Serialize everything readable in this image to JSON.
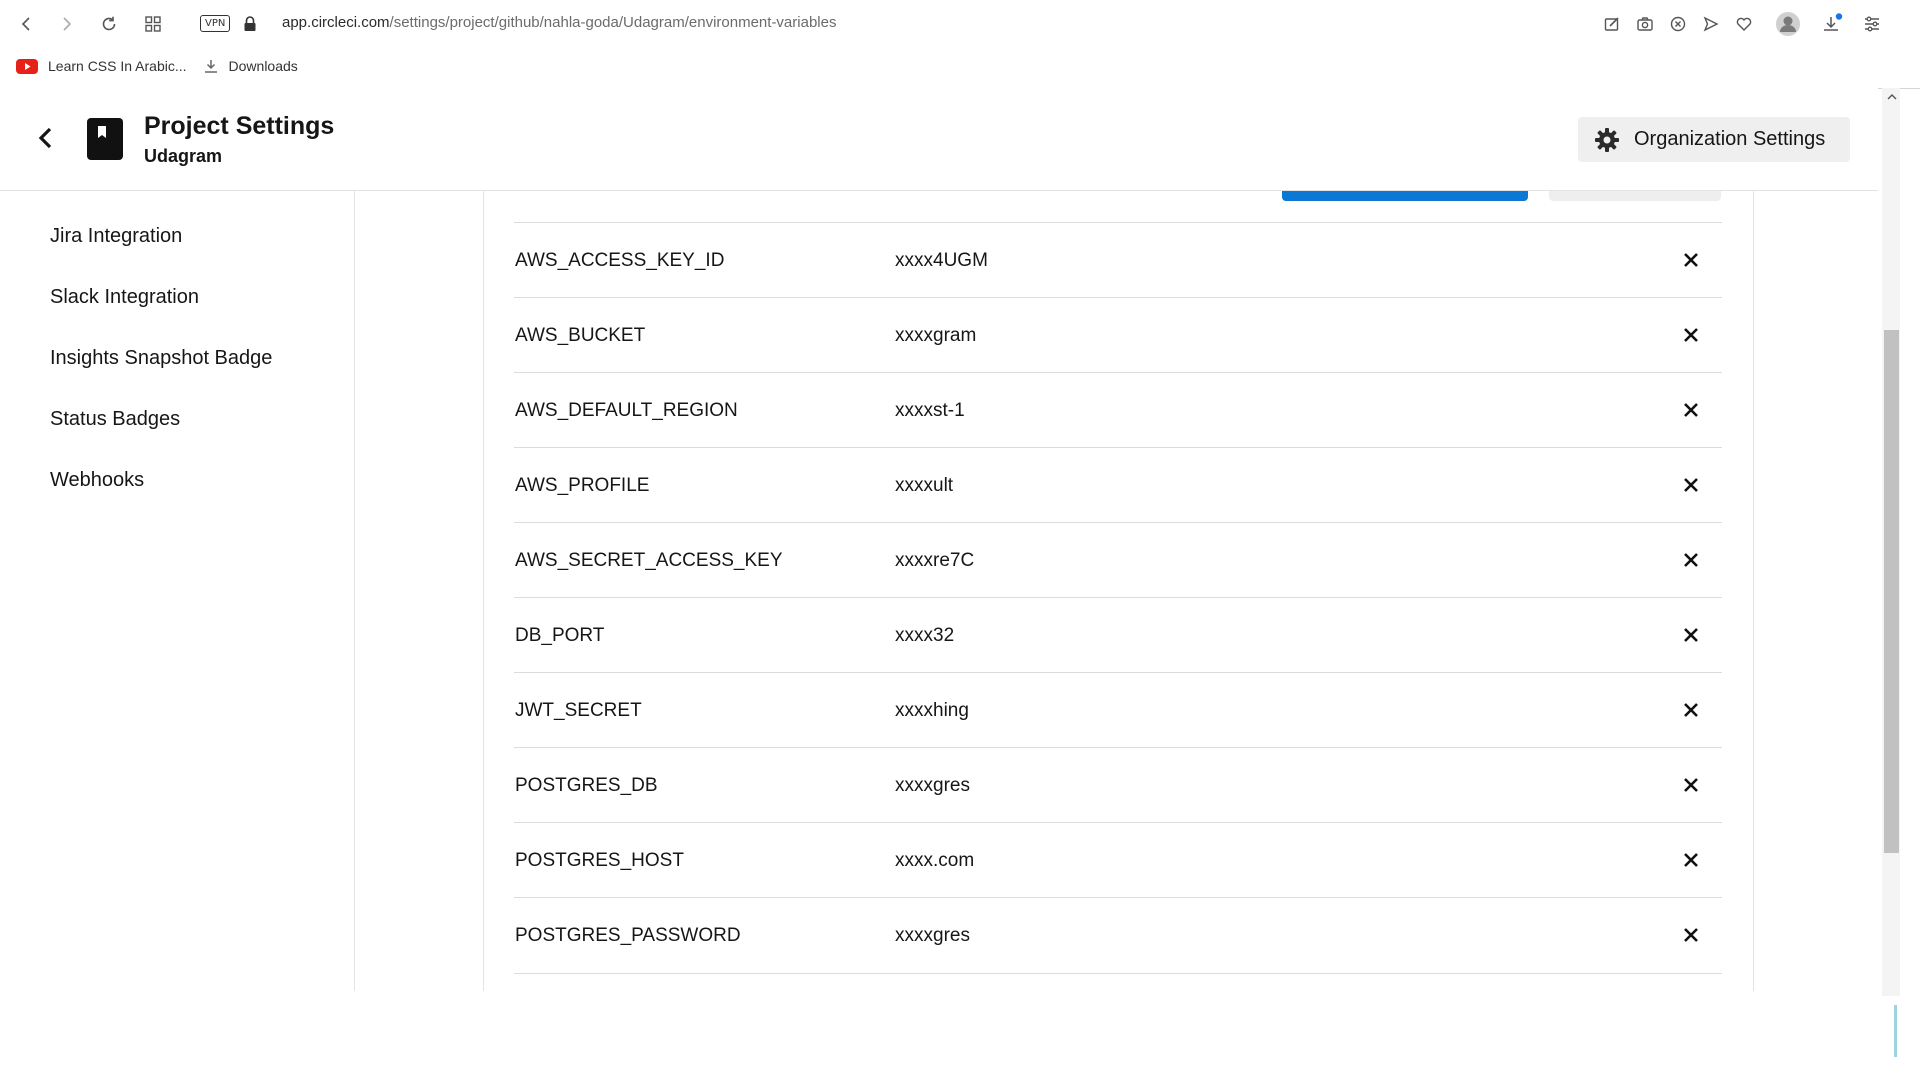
{
  "browser": {
    "url_domain": "app.circleci.com",
    "url_path": "/settings/project/github/nahla-goda/Udagram/environment-variables",
    "vpn_label": "VPN",
    "bookmarks": [
      {
        "label": "Learn CSS In Arabic...",
        "icon": "youtube-icon"
      },
      {
        "label": "Downloads",
        "icon": "download-icon"
      }
    ]
  },
  "header": {
    "title": "Project Settings",
    "subtitle": "Udagram",
    "org_button": "Organization Settings"
  },
  "sidebar": {
    "items": [
      {
        "label": "Jira Integration"
      },
      {
        "label": "Slack Integration"
      },
      {
        "label": "Insights Snapshot Badge"
      },
      {
        "label": "Status Badges"
      },
      {
        "label": "Webhooks"
      }
    ]
  },
  "env_vars": [
    {
      "name": "AWS_ACCESS_KEY_ID",
      "value": "xxxx4UGM"
    },
    {
      "name": "AWS_BUCKET",
      "value": "xxxxgram"
    },
    {
      "name": "AWS_DEFAULT_REGION",
      "value": "xxxxst-1"
    },
    {
      "name": "AWS_PROFILE",
      "value": "xxxxult"
    },
    {
      "name": "AWS_SECRET_ACCESS_KEY",
      "value": "xxxxre7C"
    },
    {
      "name": "DB_PORT",
      "value": "xxxx32"
    },
    {
      "name": "JWT_SECRET",
      "value": "xxxxhing"
    },
    {
      "name": "POSTGRES_DB",
      "value": "xxxxgres"
    },
    {
      "name": "POSTGRES_HOST",
      "value": "xxxx.com"
    },
    {
      "name": "POSTGRES_PASSWORD",
      "value": "xxxxgres"
    }
  ],
  "colors": {
    "accent": "#0b78d4",
    "text": "#161616",
    "divider": "#dcdcdc"
  }
}
